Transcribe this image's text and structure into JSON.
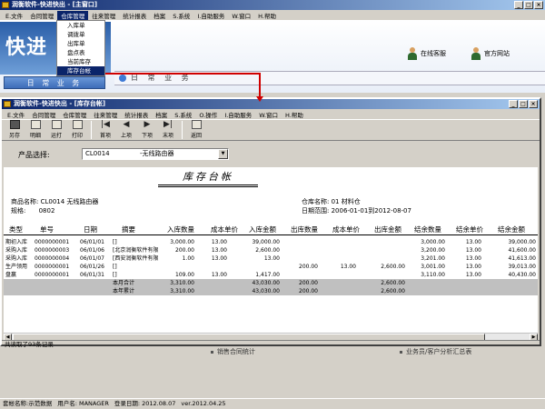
{
  "main_window": {
    "title": "润衡软件-快进快出 - [主窗口]",
    "menu": [
      "E.文件",
      "合同管理",
      "仓库管理",
      "往来管理",
      "统计报表",
      "档案",
      "S.系统",
      "I.自助服务",
      "W.窗口",
      "H.帮助"
    ],
    "active_menu_index": 2,
    "logo_text": "快进",
    "side_tab": "日 常 业 务",
    "section_title": "日 常 业 务",
    "links": [
      "在线客服",
      "官方网站"
    ],
    "below_items": [
      "销售合同统计",
      "业务员/客户分析汇总表"
    ]
  },
  "dropdown": {
    "items": [
      "入库单",
      "调拨单",
      "出库单",
      "盘点表",
      "当前库存",
      "库存台帐"
    ],
    "selected_index": 5
  },
  "inner_window": {
    "title": "润衡软件-快进快出 - [库存台帐]",
    "menu": [
      "E.文件",
      "合同管理",
      "仓库管理",
      "往来管理",
      "统计报表",
      "档案",
      "S.系统",
      "O.操作",
      "I.自助服务",
      "W.窗口",
      "H.帮助"
    ],
    "toolbar": [
      "另存",
      "明细",
      "运打",
      "打印",
      "首项",
      "上项",
      "下项",
      "末项",
      "返回"
    ],
    "filter_label": "产品选择:",
    "product_code": "CL0014",
    "product_name": "-无线路由器",
    "status": "共读取了93条记录"
  },
  "report": {
    "title": "库存台帐",
    "product_label": "商品名称:",
    "product_value": "CL0014 无线路由器",
    "spec_label": "规格:",
    "spec_value": "0802",
    "warehouse_label": "仓库名称:",
    "warehouse_value": "01     材料仓",
    "date_label": "日期范围:",
    "date_value": "2006-01-01到2012-08-07",
    "columns": [
      "类型",
      "单号",
      "日期",
      "摘要",
      "入库数量",
      "成本单价",
      "入库金额",
      "出库数量",
      "成本单价",
      "出库金额",
      "结余数量",
      "结余单价",
      "结余金额"
    ],
    "rows": [
      [
        "期初入库",
        "0000000001",
        "06/01/01",
        "[]",
        "3,000.00",
        "13.00",
        "39,000.00",
        "",
        "",
        "",
        "3,000.00",
        "13.00",
        "39,000.00"
      ],
      [
        "采购入库",
        "0000000003",
        "06/01/06",
        "[北京润衡软件有限",
        "200.00",
        "13.00",
        "2,600.00",
        "",
        "",
        "",
        "3,200.00",
        "13.00",
        "41,600.00"
      ],
      [
        "采购入库",
        "0000000004",
        "06/01/07",
        "[西安润衡软件有限",
        "1.00",
        "13.00",
        "13.00",
        "",
        "",
        "",
        "3,201.00",
        "13.00",
        "41,613.00"
      ],
      [
        "生产领用",
        "0000000001",
        "06/01/26",
        "[]",
        "",
        "",
        "",
        "200.00",
        "13.00",
        "2,600.00",
        "3,001.00",
        "13.00",
        "39,013.00"
      ],
      [
        "盘赢",
        "0000000001",
        "06/01/31",
        "[]",
        "109.00",
        "13.00",
        "1,417.00",
        "",
        "",
        "",
        "3,110.00",
        "13.00",
        "40,430.00"
      ]
    ],
    "summary": [
      [
        "本月合计",
        "3,310.00",
        "43,030.00",
        "200.00",
        "2,600.00"
      ],
      [
        "本年累计",
        "3,310.00",
        "43,030.00",
        "200.00",
        "2,600.00"
      ]
    ]
  },
  "statusbar": {
    "account": "套帐名称:示范数据",
    "user": "用户名: MANAGER",
    "login_date": "登录日期: 2012.08.07",
    "version": "ver.2012.04.25"
  }
}
